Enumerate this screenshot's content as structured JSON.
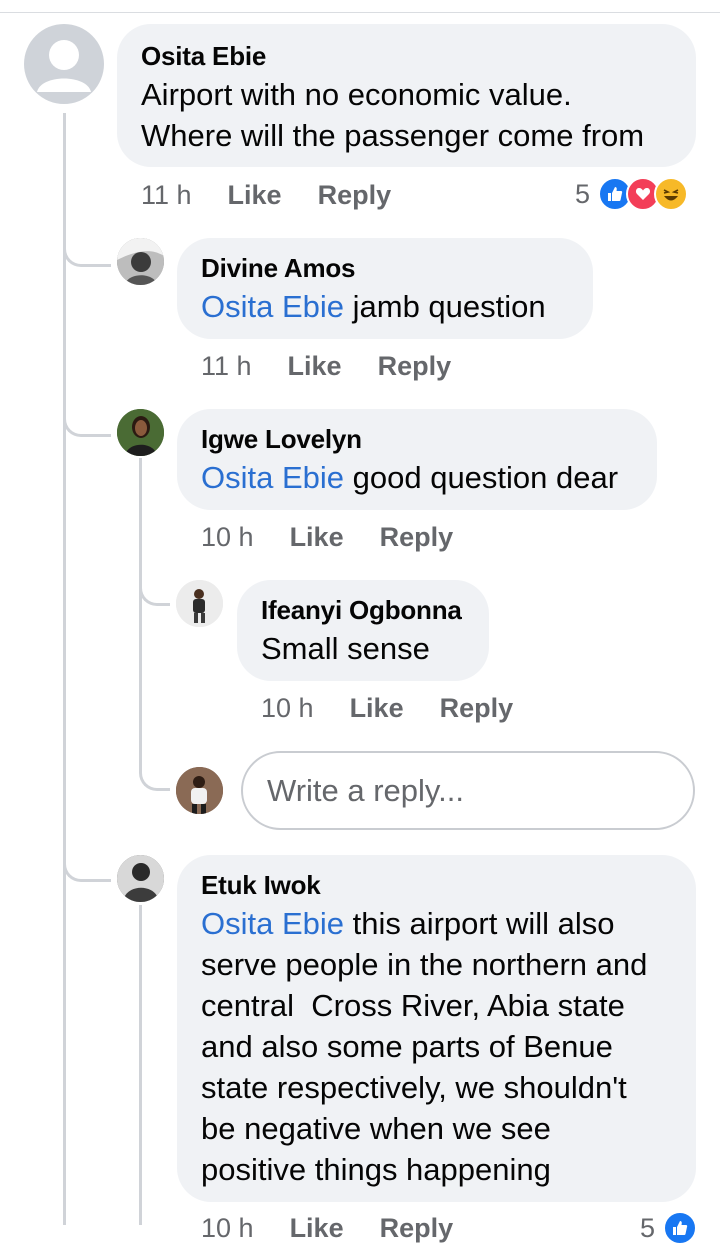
{
  "comment": {
    "author": "Osita Ebie",
    "text_line1": "Airport with no economic value.",
    "text_line2": "Where will the passenger come from",
    "time": "11 h",
    "like": "Like",
    "reply": "Reply",
    "reaction_count": "5",
    "reaction_icons": [
      "like-icon",
      "love-icon",
      "haha-icon"
    ]
  },
  "replies": [
    {
      "author": "Divine Amos",
      "mention": "Osita Ebie",
      "text": " jamb question",
      "time": "11 h",
      "like": "Like",
      "reply": "Reply"
    },
    {
      "author": "Igwe Lovelyn",
      "mention": "Osita Ebie",
      "text": " good question dear",
      "time": "10 h",
      "like": "Like",
      "reply": "Reply"
    },
    {
      "author": "Etuk Iwok",
      "mention": "Osita Ebie",
      "lines": [
        " this airport will also",
        "serve people in the northern and",
        "central  Cross River, Abia state",
        "and also some parts of Benue",
        "state respectively, we shouldn't",
        "be negative when we see",
        "positive things happening"
      ],
      "time": "10 h",
      "like": "Like",
      "reply": "Reply",
      "reaction_count": "5"
    }
  ],
  "nested_reply": {
    "author": "Ifeanyi Ogbonna",
    "text": "Small sense",
    "time": "10 h",
    "like": "Like",
    "reply": "Reply"
  },
  "reply_box": {
    "placeholder": "Write a reply..."
  },
  "colors": {
    "mention": "#2a6fd1",
    "like": "#1877f2",
    "love": "#f33e58",
    "haha": "#f7b928"
  }
}
